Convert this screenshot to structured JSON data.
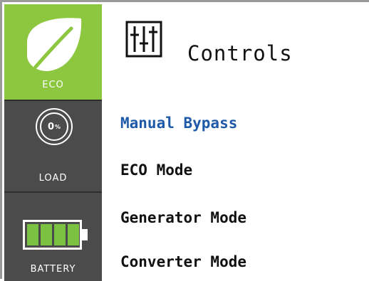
{
  "sidebar": {
    "eco": {
      "label": "ECO",
      "icon": "leaf-icon"
    },
    "load": {
      "label": "LOAD",
      "value": "0",
      "unit": "%",
      "icon": "load-gauge-icon"
    },
    "battery": {
      "label": "BATTERY",
      "icon": "battery-icon",
      "level_fraction": 1.0
    }
  },
  "header": {
    "title": "Controls",
    "icon": "sliders-icon"
  },
  "menu": {
    "items": [
      {
        "label": "Manual Bypass",
        "selected": true
      },
      {
        "label": "ECO Mode",
        "selected": false
      },
      {
        "label": "Generator Mode",
        "selected": false
      },
      {
        "label": "Converter Mode",
        "selected": false
      }
    ]
  },
  "colors": {
    "eco_green": "#8dc63f",
    "sidebar_dark": "#4b4b4b",
    "selected_blue": "#1f5aa8",
    "battery_green": "#7bc142"
  }
}
